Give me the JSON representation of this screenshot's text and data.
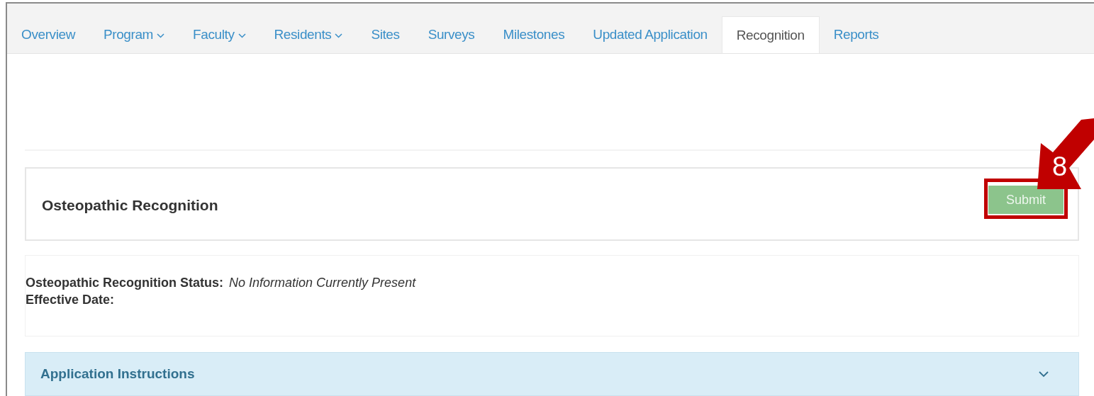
{
  "tabs": [
    {
      "label": "Overview",
      "dropdown": false,
      "selected": false
    },
    {
      "label": "Program",
      "dropdown": true,
      "selected": false
    },
    {
      "label": "Faculty",
      "dropdown": true,
      "selected": false
    },
    {
      "label": "Residents",
      "dropdown": true,
      "selected": false
    },
    {
      "label": "Sites",
      "dropdown": false,
      "selected": false
    },
    {
      "label": "Surveys",
      "dropdown": false,
      "selected": false
    },
    {
      "label": "Milestones",
      "dropdown": false,
      "selected": false
    },
    {
      "label": "Updated Application",
      "dropdown": false,
      "selected": false
    },
    {
      "label": "Recognition",
      "dropdown": false,
      "selected": true
    },
    {
      "label": "Reports",
      "dropdown": false,
      "selected": false
    }
  ],
  "panel": {
    "title": "Osteopathic Recognition",
    "button": {
      "label": "Submit",
      "disabled": true
    }
  },
  "status": {
    "label": "Osteopathic Recognition Status:",
    "value": "No Information Currently Present",
    "date_label": "Effective Date:"
  },
  "accordion": {
    "title": "Application Instructions",
    "expanded": false
  },
  "annotation": {
    "number": "8"
  }
}
